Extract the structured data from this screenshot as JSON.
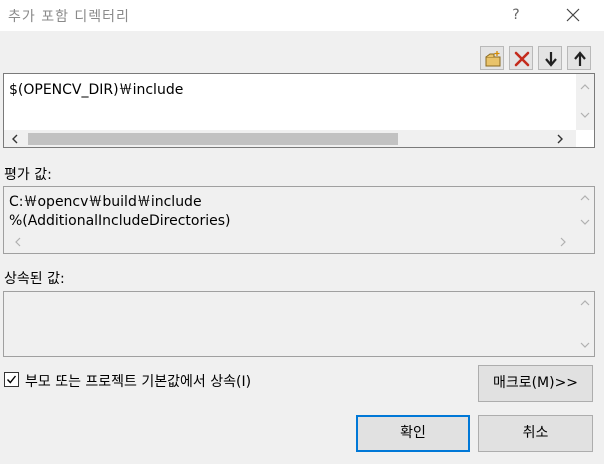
{
  "window": {
    "title": "추가 포함 디렉터리",
    "help_label": "?"
  },
  "toolbar": {
    "buttons": [
      "new-line",
      "delete",
      "move-down",
      "move-up"
    ]
  },
  "editor": {
    "value": "$(OPENCV_DIR)￦include"
  },
  "evaluated": {
    "label": "평가 값:",
    "lines": "C:￦opencv￦build￦include\n%(AdditionalIncludeDirectories)"
  },
  "inherited": {
    "label": "상속된 값:",
    "lines": ""
  },
  "inherit_checkbox": {
    "label": "부모 또는 프로젝트 기본값에서 상속(I)",
    "checked": true
  },
  "buttons": {
    "macro": "매크로(M)>>",
    "ok": "확인",
    "cancel": "취소"
  },
  "colors": {
    "delete_red": "#c42b1c",
    "new_icon_yellow": "#f0c048"
  }
}
